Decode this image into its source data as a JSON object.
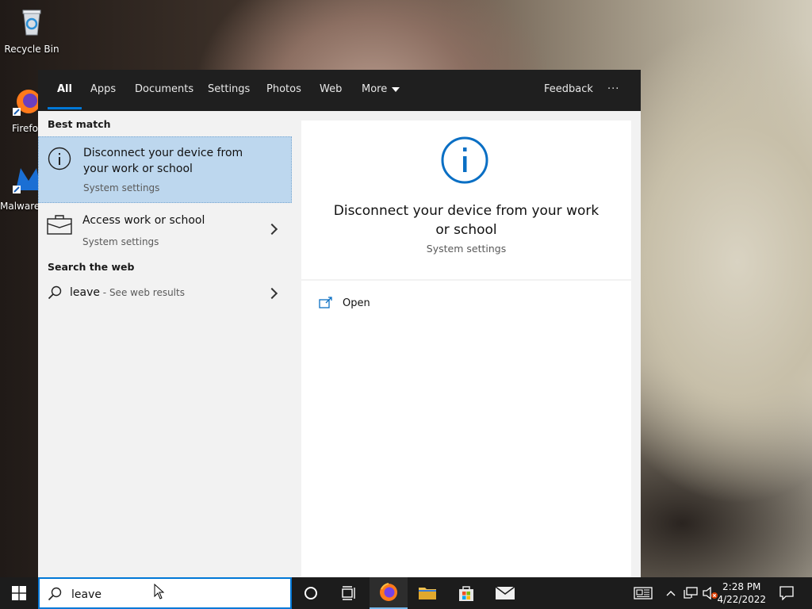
{
  "desktop": {
    "icons": [
      {
        "label": "Recycle Bin"
      },
      {
        "label": "Firefo"
      },
      {
        "label": "Malware"
      }
    ]
  },
  "tabs": [
    {
      "label": "All",
      "active": true
    },
    {
      "label": "Apps"
    },
    {
      "label": "Documents"
    },
    {
      "label": "Settings"
    },
    {
      "label": "Photos"
    },
    {
      "label": "Web"
    },
    {
      "label": "More"
    }
  ],
  "header": {
    "feedback": "Feedback",
    "more_options": "···"
  },
  "best_match": {
    "header": "Best match",
    "title": "Disconnect your device from your work or school",
    "subtitle": "System settings"
  },
  "other_results": [
    {
      "title": "Access work or school",
      "subtitle": "System settings"
    }
  ],
  "web": {
    "header": "Search the web",
    "query": "leave",
    "suffix": " - See web results"
  },
  "detail": {
    "title": "Disconnect your device from your work or school",
    "subtitle": "System settings",
    "action": "Open"
  },
  "search": {
    "value": "leave"
  },
  "taskbar": {
    "time": "2:28 PM",
    "date": "4/22/2022"
  },
  "colors": {
    "accent": "#0078d7",
    "selected": "#bdd7ee",
    "tabbar": "#1f1f1f"
  }
}
